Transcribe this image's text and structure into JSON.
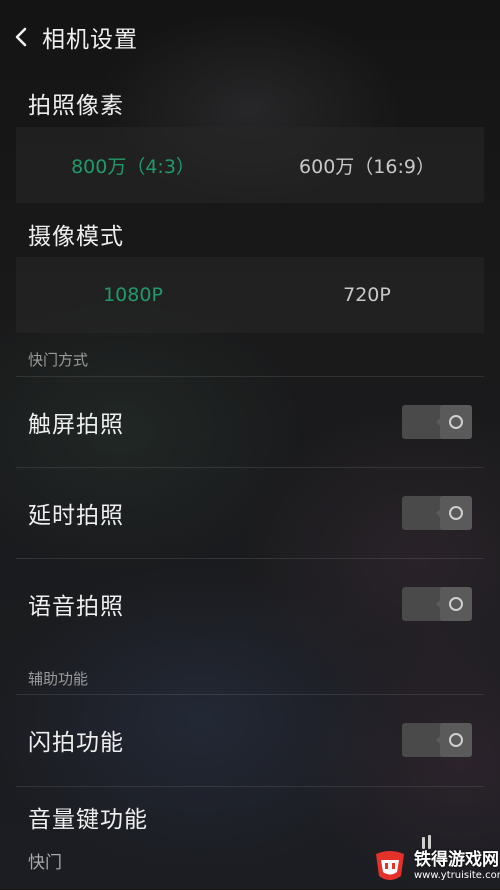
{
  "header": {
    "back_icon": "chevron-left-icon",
    "title": "相机设置"
  },
  "photo_resolution": {
    "title": "拍照像素",
    "options": [
      {
        "label": "800万（4:3）",
        "selected": true
      },
      {
        "label": "600万（16:9）",
        "selected": false
      }
    ]
  },
  "video_mode": {
    "title": "摄像模式",
    "options": [
      {
        "label": "1080P",
        "selected": true
      },
      {
        "label": "720P",
        "selected": false
      }
    ]
  },
  "shutter_section": {
    "title": "快门方式",
    "items": [
      {
        "label": "触屏拍照",
        "enabled": false
      },
      {
        "label": "延时拍照",
        "enabled": false
      },
      {
        "label": "语音拍照",
        "enabled": false
      }
    ]
  },
  "assist_section": {
    "title": "辅助功能",
    "items": [
      {
        "label": "闪拍功能",
        "enabled": false
      }
    ],
    "volume_key": {
      "label": "音量键功能",
      "value": "快门"
    }
  },
  "colors": {
    "accent": "#1f9a6a",
    "toggle_off": "#4a4a4a",
    "watermark_red": "#e4322b"
  },
  "watermark": {
    "name": "铁得游戏网",
    "url": "www.ytruisite.com"
  }
}
